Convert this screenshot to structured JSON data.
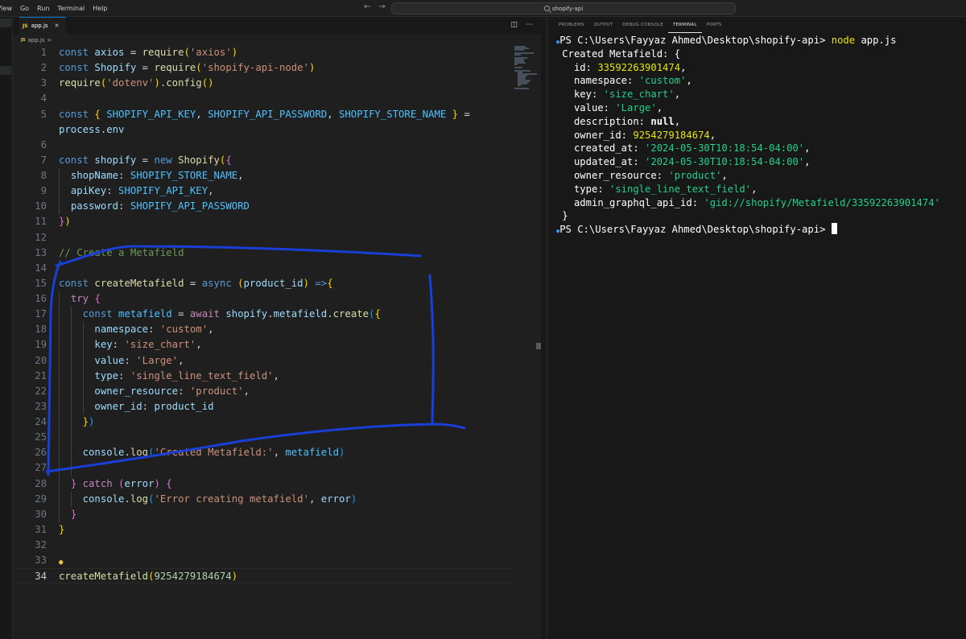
{
  "menu": [
    "View",
    "Go",
    "Run",
    "Terminal",
    "Help"
  ],
  "search": {
    "text": "shopify-api"
  },
  "tab": {
    "label": "app.js",
    "icon": "JS"
  },
  "breadcrumb": {
    "file": "app.js",
    "sep": ">"
  },
  "editor": {
    "active_line": 34,
    "lines": [
      {
        "n": "1",
        "tokens": [
          [
            "kw",
            "const "
          ],
          [
            "var",
            "axios "
          ],
          [
            "pun",
            "= "
          ],
          [
            "fn",
            "require"
          ],
          [
            "br1",
            "("
          ],
          [
            "str",
            "'axios'"
          ],
          [
            "br1",
            ")"
          ]
        ]
      },
      {
        "n": "2",
        "tokens": [
          [
            "kw",
            "const "
          ],
          [
            "var",
            "Shopify "
          ],
          [
            "pun",
            "= "
          ],
          [
            "fn",
            "require"
          ],
          [
            "br1",
            "("
          ],
          [
            "str",
            "'shopify-api-node'"
          ],
          [
            "br1",
            ")"
          ]
        ]
      },
      {
        "n": "3",
        "tokens": [
          [
            "fn",
            "require"
          ],
          [
            "br1",
            "("
          ],
          [
            "str",
            "'dotenv'"
          ],
          [
            "br1",
            ")"
          ],
          [
            "pun",
            "."
          ],
          [
            "fn",
            "config"
          ],
          [
            "br1",
            "()"
          ]
        ]
      },
      {
        "n": "4",
        "tokens": []
      },
      {
        "n": "5",
        "tokens": [
          [
            "kw",
            "const "
          ],
          [
            "br1",
            "{ "
          ],
          [
            "cst",
            "SHOPIFY_API_KEY"
          ],
          [
            "pun",
            ", "
          ],
          [
            "cst",
            "SHOPIFY_API_PASSWORD"
          ],
          [
            "pun",
            ", "
          ],
          [
            "cst",
            "SHOPIFY_STORE_NAME "
          ],
          [
            "br1",
            "} "
          ],
          [
            "pun",
            "="
          ]
        ]
      },
      {
        "n": "",
        "tokens": [
          [
            "var",
            "process"
          ],
          [
            "pun",
            "."
          ],
          [
            "var",
            "env"
          ]
        ]
      },
      {
        "n": "6",
        "tokens": []
      },
      {
        "n": "7",
        "tokens": [
          [
            "kw",
            "const "
          ],
          [
            "var",
            "shopify "
          ],
          [
            "pun",
            "= "
          ],
          [
            "kw",
            "new "
          ],
          [
            "fn",
            "Shopify"
          ],
          [
            "br1",
            "("
          ],
          [
            "br2",
            "{"
          ]
        ]
      },
      {
        "n": "8",
        "guides": [
          1
        ],
        "tokens": [
          [
            "pun",
            "  "
          ],
          [
            "var",
            "shopName"
          ],
          [
            "pun",
            ": "
          ],
          [
            "cst",
            "SHOPIFY_STORE_NAME"
          ],
          [
            "pun",
            ","
          ]
        ]
      },
      {
        "n": "9",
        "guides": [
          1
        ],
        "tokens": [
          [
            "pun",
            "  "
          ],
          [
            "var",
            "apiKey"
          ],
          [
            "pun",
            ": "
          ],
          [
            "cst",
            "SHOPIFY_API_KEY"
          ],
          [
            "pun",
            ","
          ]
        ]
      },
      {
        "n": "10",
        "guides": [
          1
        ],
        "tokens": [
          [
            "pun",
            "  "
          ],
          [
            "var",
            "password"
          ],
          [
            "pun",
            ": "
          ],
          [
            "cst",
            "SHOPIFY_API_PASSWORD"
          ]
        ]
      },
      {
        "n": "11",
        "tokens": [
          [
            "br2",
            "}"
          ],
          [
            "br1",
            ")"
          ]
        ]
      },
      {
        "n": "12",
        "tokens": []
      },
      {
        "n": "13",
        "tokens": [
          [
            "cm",
            "// Create a Metafield"
          ]
        ]
      },
      {
        "n": "14",
        "tokens": []
      },
      {
        "n": "15",
        "tokens": [
          [
            "kw",
            "const "
          ],
          [
            "fn",
            "createMetafield "
          ],
          [
            "pun",
            "= "
          ],
          [
            "kw",
            "async "
          ],
          [
            "br1",
            "("
          ],
          [
            "var",
            "product_id"
          ],
          [
            "br1",
            ") "
          ],
          [
            "kw",
            "=>"
          ],
          [
            "br1",
            "{"
          ]
        ]
      },
      {
        "n": "16",
        "guides": [
          1
        ],
        "tokens": [
          [
            "pun",
            "  "
          ],
          [
            "ctl",
            "try "
          ],
          [
            "br2",
            "{"
          ]
        ]
      },
      {
        "n": "17",
        "guides": [
          1,
          2
        ],
        "tokens": [
          [
            "pun",
            "    "
          ],
          [
            "kw",
            "const "
          ],
          [
            "cst",
            "metafield "
          ],
          [
            "pun",
            "= "
          ],
          [
            "ctl",
            "await "
          ],
          [
            "var",
            "shopify"
          ],
          [
            "pun",
            "."
          ],
          [
            "var",
            "metafield"
          ],
          [
            "pun",
            "."
          ],
          [
            "fn",
            "create"
          ],
          [
            "br3",
            "("
          ],
          [
            "br1",
            "{"
          ]
        ]
      },
      {
        "n": "18",
        "guides": [
          1,
          2,
          3
        ],
        "tokens": [
          [
            "pun",
            "      "
          ],
          [
            "var",
            "namespace"
          ],
          [
            "pun",
            ": "
          ],
          [
            "str",
            "'custom'"
          ],
          [
            "pun",
            ","
          ]
        ]
      },
      {
        "n": "19",
        "guides": [
          1,
          2,
          3
        ],
        "tokens": [
          [
            "pun",
            "      "
          ],
          [
            "var",
            "key"
          ],
          [
            "pun",
            ": "
          ],
          [
            "str",
            "'size_chart'"
          ],
          [
            "pun",
            ","
          ]
        ]
      },
      {
        "n": "20",
        "guides": [
          1,
          2,
          3
        ],
        "tokens": [
          [
            "pun",
            "      "
          ],
          [
            "var",
            "value"
          ],
          [
            "pun",
            ": "
          ],
          [
            "str",
            "'Large'"
          ],
          [
            "pun",
            ","
          ]
        ]
      },
      {
        "n": "21",
        "guides": [
          1,
          2,
          3
        ],
        "tokens": [
          [
            "pun",
            "      "
          ],
          [
            "var",
            "type"
          ],
          [
            "pun",
            ": "
          ],
          [
            "str",
            "'single_line_text_field'"
          ],
          [
            "pun",
            ","
          ]
        ]
      },
      {
        "n": "22",
        "guides": [
          1,
          2,
          3
        ],
        "tokens": [
          [
            "pun",
            "      "
          ],
          [
            "var",
            "owner_resource"
          ],
          [
            "pun",
            ": "
          ],
          [
            "str",
            "'product'"
          ],
          [
            "pun",
            ","
          ]
        ]
      },
      {
        "n": "23",
        "guides": [
          1,
          2,
          3
        ],
        "tokens": [
          [
            "pun",
            "      "
          ],
          [
            "var",
            "owner_id"
          ],
          [
            "pun",
            ": "
          ],
          [
            "var",
            "product_id"
          ]
        ]
      },
      {
        "n": "24",
        "guides": [
          1,
          2
        ],
        "tokens": [
          [
            "pun",
            "    "
          ],
          [
            "br1",
            "}"
          ],
          [
            "br3",
            ")"
          ]
        ]
      },
      {
        "n": "25",
        "guides": [
          1,
          2
        ],
        "tokens": []
      },
      {
        "n": "26",
        "guides": [
          1,
          2
        ],
        "tokens": [
          [
            "pun",
            "    "
          ],
          [
            "var",
            "console"
          ],
          [
            "pun",
            "."
          ],
          [
            "fn",
            "log"
          ],
          [
            "br3",
            "("
          ],
          [
            "str",
            "'Created Metafield:'"
          ],
          [
            "pun",
            ", "
          ],
          [
            "cst",
            "metafield"
          ],
          [
            "br3",
            ")"
          ]
        ]
      },
      {
        "n": "27",
        "guides": [
          1,
          2
        ],
        "tokens": []
      },
      {
        "n": "28",
        "guides": [
          1
        ],
        "tokens": [
          [
            "pun",
            "  "
          ],
          [
            "br2",
            "} "
          ],
          [
            "ctl",
            "catch "
          ],
          [
            "br2",
            "("
          ],
          [
            "var",
            "error"
          ],
          [
            "br2",
            ") "
          ],
          [
            "br2",
            "{"
          ]
        ]
      },
      {
        "n": "29",
        "guides": [
          1,
          2
        ],
        "tokens": [
          [
            "pun",
            "    "
          ],
          [
            "var",
            "console"
          ],
          [
            "pun",
            "."
          ],
          [
            "fn",
            "log"
          ],
          [
            "br3",
            "("
          ],
          [
            "str",
            "'Error creating metafield'"
          ],
          [
            "pun",
            ", "
          ],
          [
            "var",
            "error"
          ],
          [
            "br3",
            ")"
          ]
        ]
      },
      {
        "n": "30",
        "guides": [
          1
        ],
        "tokens": [
          [
            "pun",
            "  "
          ],
          [
            "br2",
            "}"
          ]
        ]
      },
      {
        "n": "31",
        "tokens": [
          [
            "br1",
            "}"
          ]
        ]
      },
      {
        "n": "32",
        "tokens": []
      },
      {
        "n": "33",
        "bulb": true,
        "tokens": []
      },
      {
        "n": "34",
        "tokens": [
          [
            "fn",
            "createMetafield"
          ],
          [
            "br1",
            "("
          ],
          [
            "num",
            "9254279184674"
          ],
          [
            "br1",
            ")"
          ]
        ]
      }
    ]
  },
  "panel": {
    "tabs": [
      "PROBLEMS",
      "OUTPUT",
      "DEBUG CONSOLE",
      "TERMINAL",
      "PORTS"
    ],
    "active_tab": "TERMINAL"
  },
  "terminal": {
    "lines": [
      {
        "dot": "●",
        "tokens": [
          [
            "tg",
            "PS C:\\Users\\Fayyaz Ahmed\\Desktop\\shopify-api> "
          ],
          [
            "tyel",
            "node "
          ],
          [
            "tg",
            "app.js"
          ]
        ]
      },
      {
        "tokens": [
          [
            "tg",
            "Created Metafield: {"
          ]
        ]
      },
      {
        "tokens": [
          [
            "tg",
            "  id: "
          ],
          [
            "tnum",
            "33592263901474"
          ],
          [
            "tg",
            ","
          ]
        ]
      },
      {
        "tokens": [
          [
            "tg",
            "  namespace: "
          ],
          [
            "tstr",
            "'custom'"
          ],
          [
            "tg",
            ","
          ]
        ]
      },
      {
        "tokens": [
          [
            "tg",
            "  key: "
          ],
          [
            "tstr",
            "'size_chart'"
          ],
          [
            "tg",
            ","
          ]
        ]
      },
      {
        "tokens": [
          [
            "tg",
            "  value: "
          ],
          [
            "tstr",
            "'Large'"
          ],
          [
            "tg",
            ","
          ]
        ]
      },
      {
        "tokens": [
          [
            "tg",
            "  description: "
          ],
          [
            "tbold",
            "null"
          ],
          [
            "tg",
            ","
          ]
        ]
      },
      {
        "tokens": [
          [
            "tg",
            "  owner_id: "
          ],
          [
            "tnum",
            "9254279184674"
          ],
          [
            "tg",
            ","
          ]
        ]
      },
      {
        "tokens": [
          [
            "tg",
            "  created_at: "
          ],
          [
            "tstr",
            "'2024-05-30T10:18:54-04:00'"
          ],
          [
            "tg",
            ","
          ]
        ]
      },
      {
        "tokens": [
          [
            "tg",
            "  updated_at: "
          ],
          [
            "tstr",
            "'2024-05-30T10:18:54-04:00'"
          ],
          [
            "tg",
            ","
          ]
        ]
      },
      {
        "tokens": [
          [
            "tg",
            "  owner_resource: "
          ],
          [
            "tstr",
            "'product'"
          ],
          [
            "tg",
            ","
          ]
        ]
      },
      {
        "tokens": [
          [
            "tg",
            "  type: "
          ],
          [
            "tstr",
            "'single_line_text_field'"
          ],
          [
            "tg",
            ","
          ]
        ]
      },
      {
        "tokens": [
          [
            "tg",
            "  admin_graphql_api_id: "
          ],
          [
            "tstr",
            "'gid://shopify/Metafield/33592263901474'"
          ]
        ]
      },
      {
        "tokens": [
          [
            "tg",
            "}"
          ]
        ]
      },
      {
        "dot": "●",
        "cursor": true,
        "tokens": [
          [
            "tg",
            "PS C:\\Users\\Fayyaz Ahmed\\Desktop\\shopify-api> "
          ]
        ]
      }
    ]
  },
  "colors": {
    "annotation": "#1a3fd6",
    "accent": "#0078d4"
  }
}
